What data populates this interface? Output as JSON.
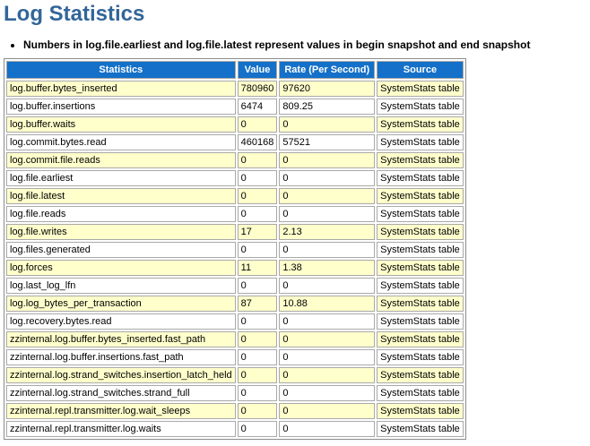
{
  "page": {
    "title": "Log Statistics",
    "note": "Numbers in log.file.earliest and log.file.latest represent values in begin snapshot and end snapshot"
  },
  "colors": {
    "title": "#336699",
    "header_bg": "#1470C8",
    "header_text": "#FFFFFF",
    "row_bg": "#FFFFFF",
    "row_alt_bg": "#FFFFCC",
    "cell_border": "#A9A9A9",
    "table_border": "#8C8C8C"
  },
  "table": {
    "columns": [
      "Statistics",
      "Value",
      "Rate (Per Second)",
      "Source"
    ],
    "rows": [
      {
        "statistic": "log.buffer.bytes_inserted",
        "value": "780960",
        "rate": "97620",
        "source": "SystemStats table"
      },
      {
        "statistic": "log.buffer.insertions",
        "value": "6474",
        "rate": "809.25",
        "source": "SystemStats table"
      },
      {
        "statistic": "log.buffer.waits",
        "value": "0",
        "rate": "0",
        "source": "SystemStats table"
      },
      {
        "statistic": "log.commit.bytes.read",
        "value": "460168",
        "rate": "57521",
        "source": "SystemStats table"
      },
      {
        "statistic": "log.commit.file.reads",
        "value": "0",
        "rate": "0",
        "source": "SystemStats table"
      },
      {
        "statistic": "log.file.earliest",
        "value": "0",
        "rate": "0",
        "source": "SystemStats table"
      },
      {
        "statistic": "log.file.latest",
        "value": "0",
        "rate": "0",
        "source": "SystemStats table"
      },
      {
        "statistic": "log.file.reads",
        "value": "0",
        "rate": "0",
        "source": "SystemStats table"
      },
      {
        "statistic": "log.file.writes",
        "value": "17",
        "rate": "2.13",
        "source": "SystemStats table"
      },
      {
        "statistic": "log.files.generated",
        "value": "0",
        "rate": "0",
        "source": "SystemStats table"
      },
      {
        "statistic": "log.forces",
        "value": "11",
        "rate": "1.38",
        "source": "SystemStats table"
      },
      {
        "statistic": "log.last_log_lfn",
        "value": "0",
        "rate": "0",
        "source": "SystemStats table"
      },
      {
        "statistic": "log.log_bytes_per_transaction",
        "value": "87",
        "rate": "10.88",
        "source": "SystemStats table"
      },
      {
        "statistic": "log.recovery.bytes.read",
        "value": "0",
        "rate": "0",
        "source": "SystemStats table"
      },
      {
        "statistic": "zzinternal.log.buffer.bytes_inserted.fast_path",
        "value": "0",
        "rate": "0",
        "source": "SystemStats table"
      },
      {
        "statistic": "zzinternal.log.buffer.insertions.fast_path",
        "value": "0",
        "rate": "0",
        "source": "SystemStats table"
      },
      {
        "statistic": "zzinternal.log.strand_switches.insertion_latch_held",
        "value": "0",
        "rate": "0",
        "source": "SystemStats table"
      },
      {
        "statistic": "zzinternal.log.strand_switches.strand_full",
        "value": "0",
        "rate": "0",
        "source": "SystemStats table"
      },
      {
        "statistic": "zzinternal.repl.transmitter.log.wait_sleeps",
        "value": "0",
        "rate": "0",
        "source": "SystemStats table"
      },
      {
        "statistic": "zzinternal.repl.transmitter.log.waits",
        "value": "0",
        "rate": "0",
        "source": "SystemStats table"
      }
    ]
  }
}
